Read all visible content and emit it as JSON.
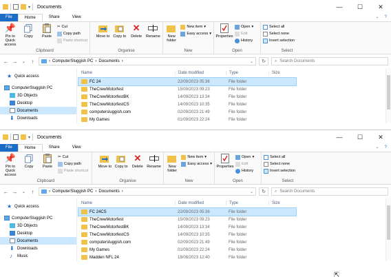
{
  "title": "Documents",
  "tabs": {
    "file": "File",
    "home": "Home",
    "share": "Share",
    "view": "View"
  },
  "window_controls": {
    "minimize": "—",
    "maximize": "☐",
    "close": "✕"
  },
  "ribbon": {
    "clipboard": {
      "pin": "Pin to Quick access",
      "copy": "Copy",
      "paste": "Paste",
      "cut": "Cut",
      "copy_path": "Copy path",
      "paste_shortcut": "Paste shortcut",
      "group": "Clipboard"
    },
    "organise": {
      "move_to": "Move to",
      "copy_to": "Copy to",
      "delete": "Delete",
      "rename": "Rename",
      "group": "Organise"
    },
    "new": {
      "new_folder": "New folder",
      "new_item": "New item",
      "easy_access": "Easy access",
      "group": "New"
    },
    "open": {
      "properties": "Properties",
      "open": "Open",
      "edit": "Edit",
      "history": "History",
      "group": "Open"
    },
    "select": {
      "select_all": "Select all",
      "select_none": "Select none",
      "invert_selection": "Invert selection",
      "group": "Select"
    }
  },
  "address": {
    "this_pc": "ComputerSluggish PC",
    "folder": "Documents",
    "search_placeholder": "Search Documents"
  },
  "columns": {
    "name": "Name",
    "date": "Date modified",
    "type": "Type",
    "size": "Size"
  },
  "window1": {
    "nav": [
      {
        "label": "Quick access"
      },
      {
        "label": "ComputerSluggish PC"
      },
      {
        "label": "3D Objects"
      },
      {
        "label": "Desktop"
      },
      {
        "label": "Documents"
      },
      {
        "label": "Downloads"
      }
    ],
    "files": [
      {
        "name": "FC 24",
        "date": "22/09/2023 05:36",
        "type": "File folder"
      },
      {
        "name": "TheCrewMotorfest",
        "date": "15/09/2023 09:23",
        "type": "File folder"
      },
      {
        "name": "TheCrewMotorfestBK",
        "date": "14/09/2023 13:34",
        "type": "File folder"
      },
      {
        "name": "TheCrewMotorfestCS",
        "date": "14/09/2023 10:35",
        "type": "File folder"
      },
      {
        "name": "computersluggish.com",
        "date": "02/09/2023 21:49",
        "type": "File folder"
      },
      {
        "name": "My Games",
        "date": "01/09/2023 22:24",
        "type": "File folder"
      }
    ]
  },
  "window2": {
    "nav": [
      {
        "label": "Quick access"
      },
      {
        "label": "ComputerSluggish PC"
      },
      {
        "label": "3D Objects"
      },
      {
        "label": "Desktop"
      },
      {
        "label": "Documents"
      },
      {
        "label": "Downloads"
      },
      {
        "label": "Music"
      }
    ],
    "files": [
      {
        "name": "FC 24CS",
        "date": "22/09/2023 05:36",
        "type": "File folder"
      },
      {
        "name": "TheCrewMotorfest",
        "date": "15/09/2023 09:23",
        "type": "File folder"
      },
      {
        "name": "TheCrewMotorfestBK",
        "date": "14/09/2023 13:34",
        "type": "File folder"
      },
      {
        "name": "TheCrewMotorfestCS",
        "date": "14/09/2023 10:35",
        "type": "File folder"
      },
      {
        "name": "computersluggish.com",
        "date": "02/09/2023 21:49",
        "type": "File folder"
      },
      {
        "name": "My Games",
        "date": "01/09/2023 22:24",
        "type": "File folder"
      },
      {
        "name": "Madden NFL 24",
        "date": "18/08/2023 12:40",
        "type": "File folder"
      }
    ]
  }
}
